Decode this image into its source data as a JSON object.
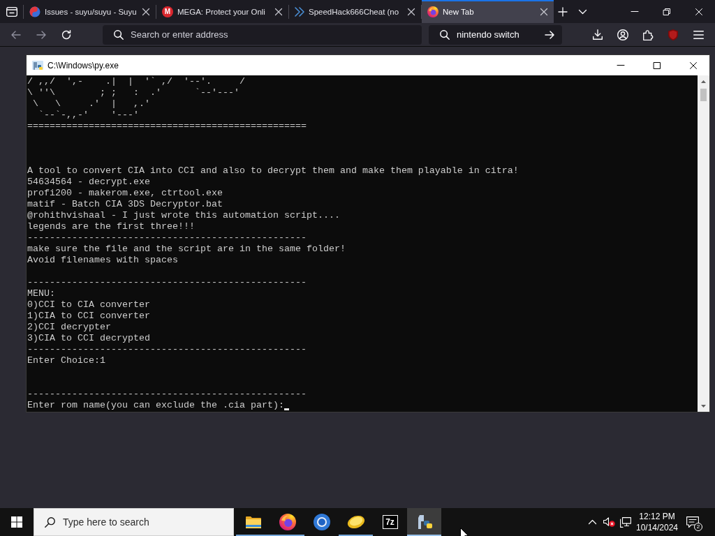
{
  "browser": {
    "tabs": [
      {
        "title": "Issues - suyu/suyu - Suyu",
        "selected": false
      },
      {
        "title": "MEGA: Protect your Onli",
        "selected": false,
        "logo_text": "M"
      },
      {
        "title": "SpeedHack666Cheat (no",
        "selected": false
      },
      {
        "title": "New Tab",
        "selected": true
      }
    ],
    "address_bar": {
      "placeholder": "Search or enter address"
    },
    "search_bar": {
      "value": "nintendo switch"
    }
  },
  "console_window": {
    "title": "C:\\Windows\\py.exe",
    "lines": [
      {
        "kind": "text",
        "text": "/ ,,/  ',-    .|  |  '` ,/  '--'.     /"
      },
      {
        "kind": "text",
        "text": "\\ ''\\        ; ;   :  .'      `--'---'"
      },
      {
        "kind": "text",
        "text": " \\   \\     .'  |   ,.'"
      },
      {
        "kind": "text",
        "text": "  `--`-,,-'    '---'"
      },
      {
        "kind": "text",
        "text": "=================================================="
      },
      {
        "kind": "blank"
      },
      {
        "kind": "blank"
      },
      {
        "kind": "blank"
      },
      {
        "kind": "text",
        "text": "A tool to convert CIA into CCI and also to decrypt them and make them playable in citra!"
      },
      {
        "kind": "text",
        "text": "54634564 - decrypt.exe"
      },
      {
        "kind": "text",
        "text": "profi200 - makerom.exe, ctrtool.exe"
      },
      {
        "kind": "text",
        "text": "matif - Batch CIA 3DS Decryptor.bat"
      },
      {
        "kind": "text",
        "text": "@rohithvishaal - I just wrote this automation script...."
      },
      {
        "kind": "text",
        "text": "legends are the first three!!!"
      },
      {
        "kind": "text",
        "text": "--------------------------------------------------"
      },
      {
        "kind": "text",
        "text": "make sure the file and the script are in the same folder!"
      },
      {
        "kind": "text",
        "text": "Avoid filenames with spaces"
      },
      {
        "kind": "blank"
      },
      {
        "kind": "text",
        "text": "--------------------------------------------------"
      },
      {
        "kind": "text",
        "text": "MENU:"
      },
      {
        "kind": "text",
        "text": "0)CCI to CIA converter"
      },
      {
        "kind": "text",
        "text": "1)CIA to CCI converter"
      },
      {
        "kind": "text",
        "text": "2)CCI decrypter"
      },
      {
        "kind": "text",
        "text": "3)CIA to CCI decrypted"
      },
      {
        "kind": "text",
        "text": "--------------------------------------------------"
      },
      {
        "kind": "text",
        "text": "Enter Choice:1"
      },
      {
        "kind": "blank"
      },
      {
        "kind": "blank"
      },
      {
        "kind": "text",
        "text": "--------------------------------------------------"
      },
      {
        "kind": "prompt",
        "text": "Enter rom name(you can exclude the .cia part):"
      }
    ]
  },
  "taskbar": {
    "search": {
      "placeholder": "Type here to search"
    },
    "apps": [
      {
        "running": true,
        "selected": false
      },
      {
        "running": true,
        "selected": false
      },
      {
        "running": false,
        "selected": false
      },
      {
        "running": true,
        "selected": false
      },
      {
        "running": false,
        "selected": false,
        "logo_text": "7z"
      },
      {
        "running": true,
        "selected": true
      }
    ],
    "clock": {
      "time": "12:12 PM",
      "date": "10/14/2024"
    },
    "notifications": {
      "count": "2"
    }
  }
}
